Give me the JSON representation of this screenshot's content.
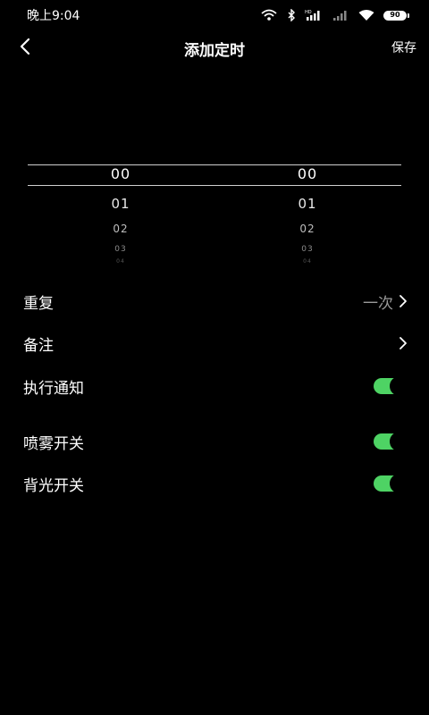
{
  "status_bar": {
    "time": "晚上9:04",
    "battery_level": "90",
    "icons": [
      "wifi-hotspot-icon",
      "bluetooth-icon",
      "signal-hd-icon",
      "signal-weak-icon",
      "wifi-icon",
      "battery-icon"
    ]
  },
  "nav": {
    "title": "添加定时",
    "save_label": "保存",
    "back_icon": "chevron-left-icon"
  },
  "picker": {
    "hours": [
      "00",
      "01",
      "02",
      "03",
      "04"
    ],
    "minutes": [
      "00",
      "01",
      "02",
      "03",
      "04"
    ]
  },
  "settings": {
    "repeat": {
      "label": "重复",
      "value": "一次"
    },
    "note": {
      "label": "备注"
    },
    "notify": {
      "label": "执行通知",
      "on": true
    },
    "spray": {
      "label": "喷雾开关",
      "on": true
    },
    "backlight": {
      "label": "背光开关",
      "on": true
    }
  },
  "colors": {
    "background": "#000000",
    "toggle_on": "#4ed364",
    "secondary_text": "#9a9a9a"
  }
}
